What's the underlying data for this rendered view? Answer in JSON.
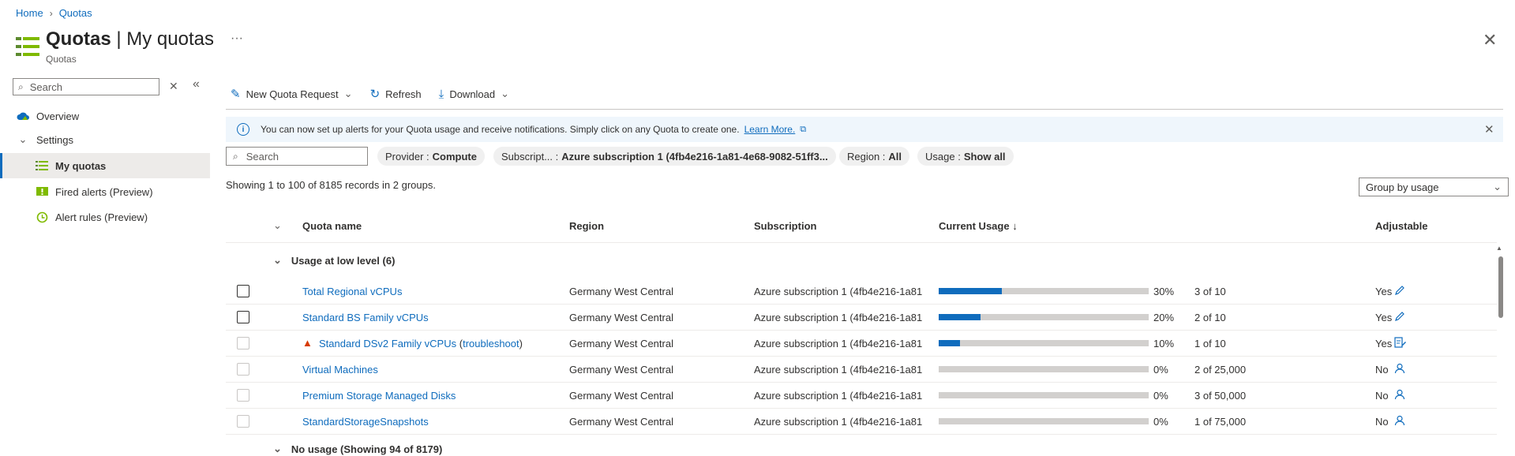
{
  "breadcrumb": [
    "Home",
    "Quotas"
  ],
  "header": {
    "title_main": "Quotas",
    "title_sep": " | ",
    "title_sub": "My quotas",
    "subtitle": "Quotas",
    "more": "···",
    "close": "✕"
  },
  "nav": {
    "search_placeholder": "Search",
    "items": [
      {
        "label": "Overview"
      },
      {
        "label": "Settings"
      },
      {
        "label": "My quotas"
      },
      {
        "label": "Fired alerts (Preview)"
      },
      {
        "label": "Alert rules (Preview)"
      }
    ]
  },
  "toolbar": {
    "new_request": "New Quota Request",
    "refresh": "Refresh",
    "download": "Download"
  },
  "info": {
    "text": "You can now set up alerts for your Quota usage and receive notifications. Simply click on any Quota to create one.",
    "link": "Learn More."
  },
  "filters": {
    "search_placeholder": "Search",
    "provider_label": "Provider :",
    "provider_value": "Compute",
    "subscription_label": "Subscript... :",
    "subscription_value": "Azure subscription 1 (4fb4e216-1a81-4e68-9082-51ff3...",
    "region_label": "Region :",
    "region_value": "All",
    "usage_label": "Usage :",
    "usage_value": "Show all"
  },
  "records_text": "Showing 1 to 100 of 8185 records in 2 groups.",
  "group_by": "Group by usage",
  "columns": {
    "name": "Quota name",
    "region": "Region",
    "subscription": "Subscription",
    "usage": "Current Usage ↓",
    "adjustable": "Adjustable"
  },
  "groups": [
    {
      "label": "Usage at low level (6)"
    },
    {
      "label": "No usage (Showing 94 of 8179)"
    }
  ],
  "rows": [
    {
      "name": "Total Regional vCPUs",
      "region": "Germany West Central",
      "subscription": "Azure subscription 1 (4fb4e216-1a81",
      "percent": 30,
      "percent_text": "30%",
      "count": "3 of 10",
      "adjustable": "Yes",
      "action_icon": "pencil-icon"
    },
    {
      "name": "Standard BS Family vCPUs",
      "region": "Germany West Central",
      "subscription": "Azure subscription 1 (4fb4e216-1a81",
      "percent": 20,
      "percent_text": "20%",
      "count": "2 of 10",
      "adjustable": "Yes",
      "action_icon": "pencil-icon"
    },
    {
      "name": "Standard DSv2 Family vCPUs",
      "troubleshoot": "troubleshoot",
      "region": "Germany West Central",
      "subscription": "Azure subscription 1 (4fb4e216-1a81",
      "percent": 10,
      "percent_text": "10%",
      "count": "1 of 10",
      "adjustable": "Yes",
      "action_icon": "document-edit-icon"
    },
    {
      "name": "Virtual Machines",
      "region": "Germany West Central",
      "subscription": "Azure subscription 1 (4fb4e216-1a81",
      "percent": 0,
      "percent_text": "0%",
      "count": "2 of 25,000",
      "adjustable": "No",
      "action_icon": "person-icon"
    },
    {
      "name": "Premium Storage Managed Disks",
      "region": "Germany West Central",
      "subscription": "Azure subscription 1 (4fb4e216-1a81",
      "percent": 0,
      "percent_text": "0%",
      "count": "3 of 50,000",
      "adjustable": "No",
      "action_icon": "person-icon"
    },
    {
      "name": "StandardStorageSnapshots",
      "region": "Germany West Central",
      "subscription": "Azure subscription 1 (4fb4e216-1a81",
      "percent": 0,
      "percent_text": "0%",
      "count": "1 of 75,000",
      "adjustable": "No",
      "action_icon": "person-icon"
    }
  ],
  "colors": {
    "accent": "#0f6cbd",
    "bar_track": "#d2d0ce",
    "warning": "#d83b01",
    "info_bg": "#eff6fc"
  }
}
